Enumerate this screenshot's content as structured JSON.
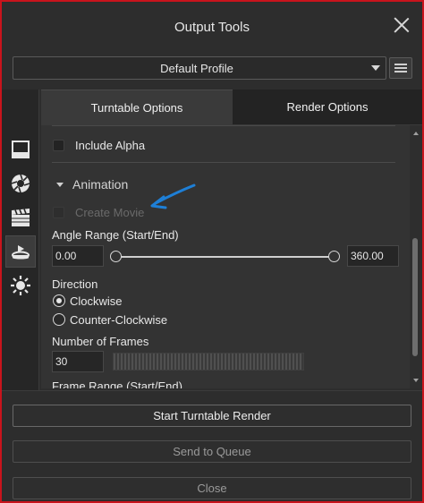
{
  "window": {
    "title": "Output Tools"
  },
  "profile": {
    "selected": "Default Profile"
  },
  "tabs": [
    {
      "label": "Turntable Options",
      "active": true
    },
    {
      "label": "Render Options",
      "active": false
    }
  ],
  "sidebar": {
    "icons": [
      "viewport-icon",
      "aperture-icon",
      "clapperboard-icon",
      "turntable-icon",
      "light-icon"
    ],
    "active": "turntable-icon"
  },
  "options": {
    "include_alpha": {
      "label": "Include Alpha",
      "checked": false
    },
    "animation": {
      "header": "Animation",
      "create_movie": {
        "label": "Create Movie",
        "checked": false,
        "enabled": false
      }
    },
    "angle_range": {
      "label": "Angle Range (Start/End)",
      "start": "0.00",
      "end": "360.00"
    },
    "direction": {
      "label": "Direction",
      "options": [
        {
          "label": "Clockwise",
          "selected": true
        },
        {
          "label": "Counter-Clockwise",
          "selected": false
        }
      ]
    },
    "frames": {
      "label": "Number of Frames",
      "value": "30"
    },
    "frame_range": {
      "label": "Frame Range (Start/End)"
    }
  },
  "buttons": {
    "start": "Start Turntable Render",
    "queue": "Send to Queue",
    "close": "Close"
  },
  "colors": {
    "accent_annotation": "#1e7fd6",
    "window_border": "#c8141c"
  }
}
